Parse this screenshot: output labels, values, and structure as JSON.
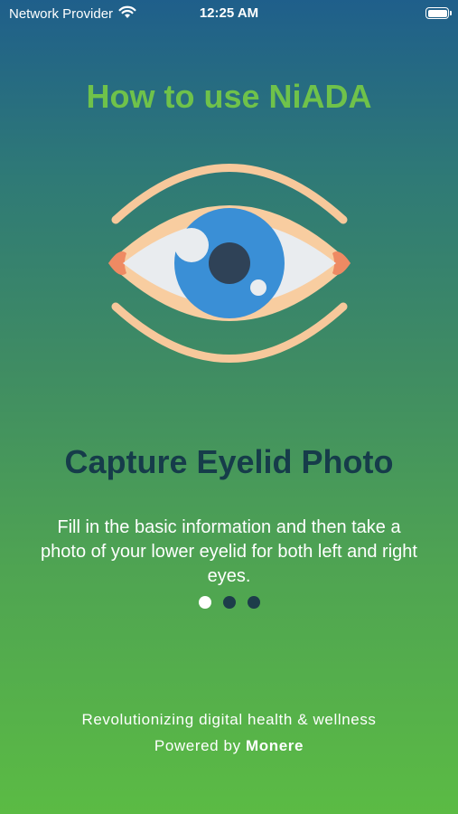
{
  "status_bar": {
    "carrier": "Network Provider",
    "time": "12:25 AM",
    "wifi_icon": "wifi-icon",
    "battery_icon": "battery-icon"
  },
  "title": "How to use NiADA",
  "illustration": {
    "icon": "eye-icon"
  },
  "heading": "Capture Eyelid Photo",
  "description": "Fill in the basic information and then take a photo of your lower eyelid for both left and right eyes.",
  "pagination": {
    "total": 3,
    "current": 1
  },
  "footer": {
    "tagline": "Revolutionizing digital health & wellness",
    "powered_prefix": "Powered by",
    "brand": "Monere"
  },
  "colors": {
    "title": "#6fc24a",
    "heading": "#163c4a",
    "gradient_top": "#1f5f8b",
    "gradient_bottom": "#5bbb44",
    "dot_active": "#ffffff",
    "dot_inactive": "#1d3d4a"
  }
}
